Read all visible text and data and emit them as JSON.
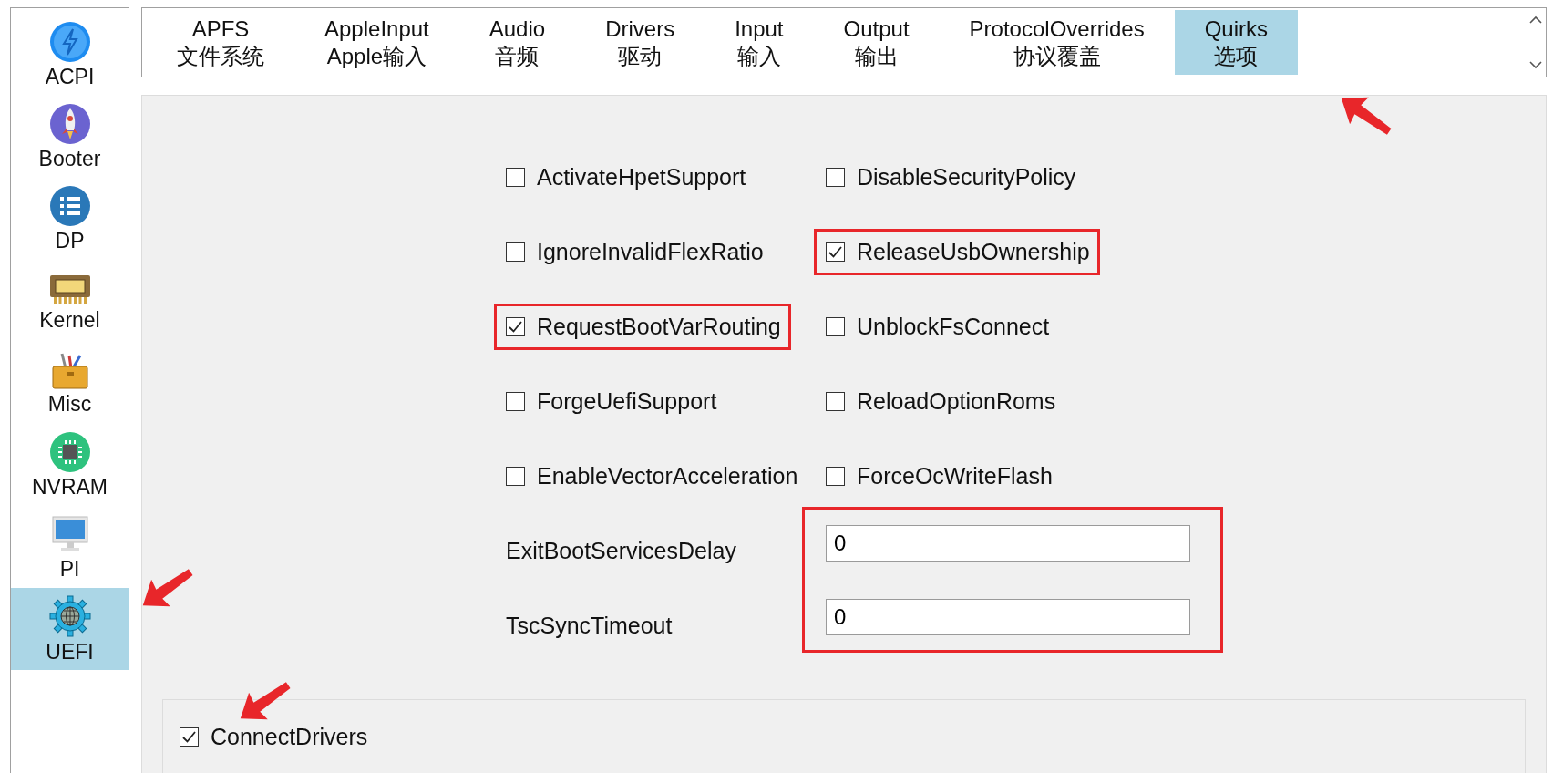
{
  "sidebar": {
    "items": [
      {
        "label": "ACPI",
        "selected": false
      },
      {
        "label": "Booter",
        "selected": false
      },
      {
        "label": "DP",
        "selected": false
      },
      {
        "label": "Kernel",
        "selected": false
      },
      {
        "label": "Misc",
        "selected": false
      },
      {
        "label": "NVRAM",
        "selected": false
      },
      {
        "label": "PI",
        "selected": false
      },
      {
        "label": "UEFI",
        "selected": true
      }
    ]
  },
  "tabs": [
    {
      "title": "APFS",
      "subtitle": "文件系统",
      "selected": false
    },
    {
      "title": "AppleInput",
      "subtitle": "Apple输入",
      "selected": false
    },
    {
      "title": "Audio",
      "subtitle": "音频",
      "selected": false
    },
    {
      "title": "Drivers",
      "subtitle": "驱动",
      "selected": false
    },
    {
      "title": "Input",
      "subtitle": "输入",
      "selected": false
    },
    {
      "title": "Output",
      "subtitle": "输出",
      "selected": false
    },
    {
      "title": "ProtocolOverrides",
      "subtitle": "协议覆盖",
      "selected": false
    },
    {
      "title": "Quirks",
      "subtitle": "选项",
      "selected": true
    }
  ],
  "quirks": [
    {
      "label": "ActivateHpetSupport",
      "checked": false,
      "highlighted": false
    },
    {
      "label": "DisableSecurityPolicy",
      "checked": false,
      "highlighted": false
    },
    {
      "label": "IgnoreInvalidFlexRatio",
      "checked": false,
      "highlighted": false
    },
    {
      "label": "ReleaseUsbOwnership",
      "checked": true,
      "highlighted": true
    },
    {
      "label": "RequestBootVarRouting",
      "checked": true,
      "highlighted": true
    },
    {
      "label": "UnblockFsConnect",
      "checked": false,
      "highlighted": false
    },
    {
      "label": "ForgeUefiSupport",
      "checked": false,
      "highlighted": false
    },
    {
      "label": "ReloadOptionRoms",
      "checked": false,
      "highlighted": false
    },
    {
      "label": "EnableVectorAcceleration",
      "checked": false,
      "highlighted": false
    },
    {
      "label": "ForceOcWriteFlash",
      "checked": false,
      "highlighted": false
    }
  ],
  "fields": {
    "highlighted": true,
    "items": [
      {
        "label": "ExitBootServicesDelay",
        "value": "0"
      },
      {
        "label": "TscSyncTimeout",
        "value": "0"
      }
    ]
  },
  "connect_drivers": {
    "label": "ConnectDrivers",
    "checked": true
  }
}
